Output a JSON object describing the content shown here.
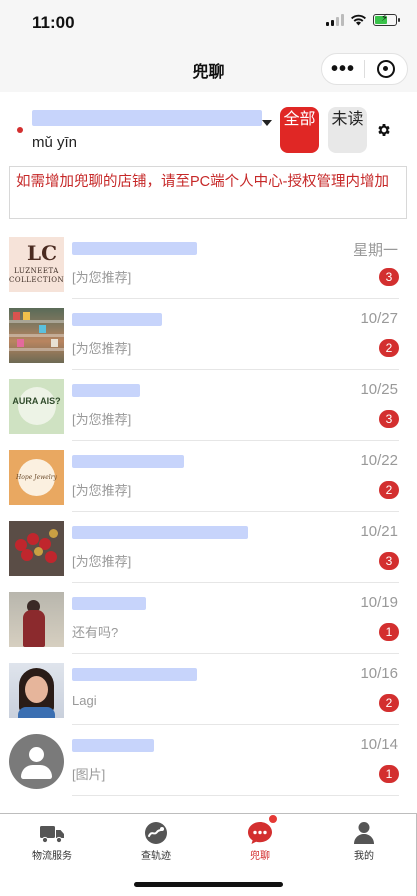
{
  "status_bar": {
    "time": "11:00"
  },
  "header": {
    "title": "兜聊"
  },
  "shop": {
    "name_visible_prefix": "",
    "name_line2": "mǔ yīn",
    "filter_all": "全部",
    "filter_unread": "未读"
  },
  "notice": {
    "text": "如需增加兜聊的店铺，请至PC端个人中心-授权管理内增加"
  },
  "conversations": [
    {
      "avatar": "luzneeta-collection",
      "date": "星期一",
      "preview": "[为您推荐]",
      "unread": "3",
      "avatar_mono": "LC",
      "avatar_line1": "LUZNEETA",
      "avatar_line2": "COLLECTION"
    },
    {
      "avatar": "store-shelves",
      "date": "10/27",
      "preview": "[为您推荐]",
      "unread": "2"
    },
    {
      "avatar": "aura-logo",
      "date": "10/25",
      "preview": "[为您推荐]",
      "unread": "3",
      "avatar_text": "AURA AIS?"
    },
    {
      "avatar": "hope-logo",
      "date": "10/22",
      "preview": "[为您推荐]",
      "unread": "2",
      "avatar_text": "Hope Jewelry"
    },
    {
      "avatar": "rose-bouquet",
      "date": "10/21",
      "preview": "[为您推荐]",
      "unread": "3"
    },
    {
      "avatar": "lady-photo",
      "date": "10/19",
      "preview": "还有吗?",
      "unread": "1"
    },
    {
      "avatar": "girl-photo",
      "date": "10/16",
      "preview": "Lagi",
      "unread": "2"
    },
    {
      "avatar": "default-user",
      "date": "10/14",
      "preview": "[图片]",
      "unread": "1"
    }
  ],
  "tabs": [
    {
      "label": "物流服务",
      "icon": "truck-icon"
    },
    {
      "label": "查轨迹",
      "icon": "track-icon"
    },
    {
      "label": "兜聊",
      "icon": "chat-icon",
      "active": true
    },
    {
      "label": "我的",
      "icon": "user-icon"
    }
  ],
  "colors": {
    "accent": "#e02725",
    "badge": "#d32f2f",
    "notice_text": "#c62828",
    "redaction": "#c7d4fb"
  }
}
